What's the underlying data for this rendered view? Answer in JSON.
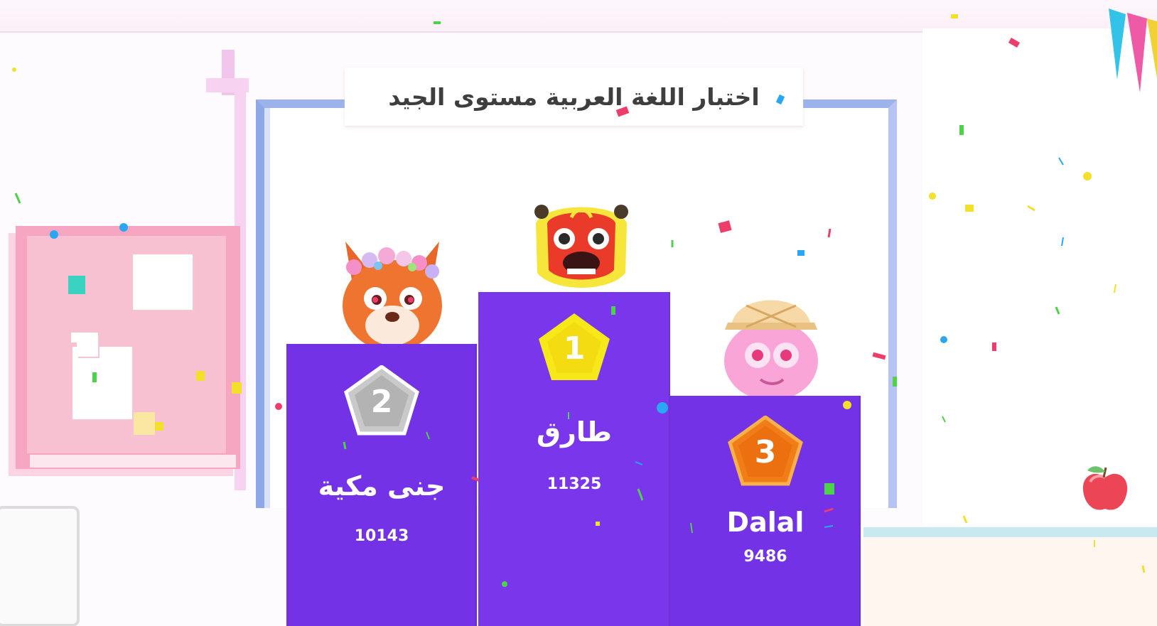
{
  "quiz": {
    "title": "اختبار اللغة العربية مستوى الجيد"
  },
  "podium": {
    "first": {
      "rank": "1",
      "name": "طارق",
      "score": "11325",
      "badge_color": "#f7e81a",
      "avatar": "lion-dance-avatar"
    },
    "second": {
      "rank": "2",
      "name": "جنى مكية",
      "score": "10143",
      "badge_color": "#b9b9b9",
      "avatar": "fox-flower-crown-avatar"
    },
    "third": {
      "rank": "3",
      "name": "Dalal",
      "score": "9486",
      "badge_color": "#f07d18",
      "avatar": "pink-explorer-avatar"
    }
  },
  "colors": {
    "podium": "#7432e6",
    "title_text": "#3e3e3e",
    "whiteboard_frame": "#8ea7e6",
    "corkboard": "#f7a6c1"
  },
  "icons": [
    "pentagon-badge-icon",
    "apple-icon",
    "bunting-icon",
    "pushpin-icon"
  ]
}
